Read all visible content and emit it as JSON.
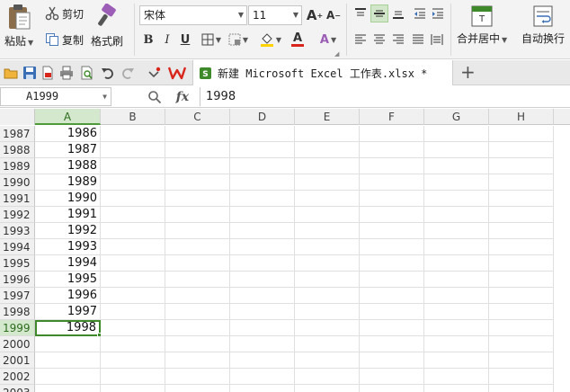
{
  "ribbon": {
    "paste_label": "粘贴",
    "cut_label": "剪切",
    "copy_label": "复制",
    "format_painter_label": "格式刷",
    "font_name": "宋体",
    "font_size": "11",
    "merge_center_label": "合并居中",
    "wrap_text_label": "自动换行",
    "bold": "B",
    "italic": "I",
    "underline": "U",
    "grow_font": "A",
    "shrink_font": "A",
    "font_color_letter": "A",
    "clear_letter": "A"
  },
  "tabs": {
    "document_title": "新建 Microsoft Excel 工作表.xlsx *",
    "new_tab_symbol": "+"
  },
  "formula_bar": {
    "cell_ref": "A1999",
    "fx_label": "fx",
    "value": "1998"
  },
  "sheet": {
    "columns": [
      "A",
      "B",
      "C",
      "D",
      "E",
      "F",
      "G",
      "H"
    ],
    "selected_column": "A",
    "rows": [
      {
        "num": "1987",
        "a": "1986"
      },
      {
        "num": "1988",
        "a": "1987"
      },
      {
        "num": "1989",
        "a": "1988"
      },
      {
        "num": "1990",
        "a": "1989"
      },
      {
        "num": "1991",
        "a": "1990"
      },
      {
        "num": "1992",
        "a": "1991"
      },
      {
        "num": "1993",
        "a": "1992"
      },
      {
        "num": "1994",
        "a": "1993"
      },
      {
        "num": "1995",
        "a": "1994"
      },
      {
        "num": "1996",
        "a": "1995"
      },
      {
        "num": "1997",
        "a": "1996"
      },
      {
        "num": "1998",
        "a": "1997"
      },
      {
        "num": "1999",
        "a": "1998"
      },
      {
        "num": "2000",
        "a": ""
      },
      {
        "num": "2001",
        "a": ""
      },
      {
        "num": "2002",
        "a": ""
      },
      {
        "num": "2003",
        "a": ""
      }
    ],
    "selected_row": "1999"
  },
  "colors": {
    "accent_green": "#3e8a2a",
    "selected_header_bg": "#d3e8cc",
    "wps_red": "#d9261c"
  }
}
